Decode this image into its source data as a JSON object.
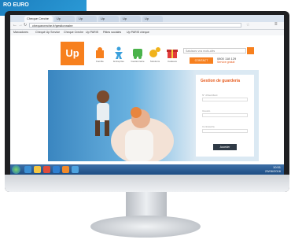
{
  "corner_text": "RO EURO",
  "browser": {
    "tabs": [
      "Cheque Creche",
      "Up",
      "Up",
      "Up",
      "Up",
      "Up"
    ],
    "url": "chequecreche.fr/gestionnaire",
    "bookmarks": [
      "Marcadores",
      "Chequé Up Service",
      "Cheque Creche",
      "Up PARIS",
      "Pâtes sociales",
      "Up PARIS cheque"
    ]
  },
  "site": {
    "logo": "Up",
    "nav": [
      {
        "label": "Famille",
        "color": "#f7801e"
      },
      {
        "label": "Entreprise",
        "color": "#3aa0dc"
      },
      {
        "label": "Gestionnaire",
        "color": "#4bb34b"
      },
      {
        "label": "Solutions",
        "color": "#f0b21b"
      },
      {
        "label": "Cadeaux",
        "color": "#e23b3b"
      }
    ],
    "search_placeholder": "Saisissez vos mots-clés",
    "contact_button": "CONTACT",
    "phone": "0800 118 129",
    "phone_sub": "Service gratuit"
  },
  "login_form": {
    "title": "Gestion de guardería",
    "fields": [
      "N° d'Identifiant",
      "Usuario",
      "Contraseña"
    ],
    "submit": "Acceder"
  },
  "taskbar": {
    "time": "10:51",
    "date": "23/06/2016"
  }
}
